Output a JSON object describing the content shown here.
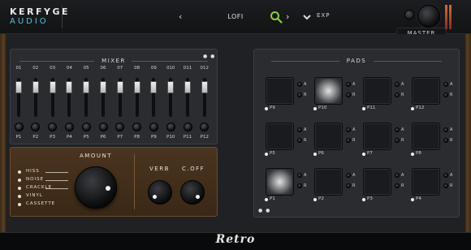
{
  "brand": {
    "top": "KERFYGE",
    "bottom": "AUDIO"
  },
  "preset": {
    "name": "LOFI",
    "prev_glyph": "‹",
    "next_glyph": "›"
  },
  "header": {
    "exp_label": "EXP"
  },
  "master": {
    "label": "MASTER"
  },
  "mixer": {
    "title": "MIXER",
    "dots": "● ●",
    "channels": [
      {
        "bus": "01",
        "pan": "P1"
      },
      {
        "bus": "02",
        "pan": "P2"
      },
      {
        "bus": "03",
        "pan": "P3"
      },
      {
        "bus": "04",
        "pan": "P4"
      },
      {
        "bus": "05",
        "pan": "P5"
      },
      {
        "bus": "06",
        "pan": "P6"
      },
      {
        "bus": "07",
        "pan": "P7"
      },
      {
        "bus": "08",
        "pan": "P8"
      },
      {
        "bus": "09",
        "pan": "P9"
      },
      {
        "bus": "010",
        "pan": "P10"
      },
      {
        "bus": "011",
        "pan": "P11"
      },
      {
        "bus": "012",
        "pan": "P12"
      }
    ]
  },
  "fx": {
    "amount_label": "AMOUNT",
    "items": [
      "HISS",
      "NOISE",
      "CRACKLE",
      "VINYL",
      "CASSETTE"
    ],
    "verb_label": "VERB",
    "cutoff_label": "C.OFF"
  },
  "pads": {
    "title": "PADS",
    "dots": "● ●",
    "ctl_a": "A",
    "ctl_r": "R",
    "rows": [
      [
        "P9",
        "P10",
        "P11",
        "P12"
      ],
      [
        "P5",
        "P6",
        "P7",
        "P8"
      ],
      [
        "P1",
        "P2",
        "P3",
        "P4"
      ]
    ],
    "active": [
      "P10",
      "P1"
    ]
  },
  "footer": {
    "logo": "Retro"
  },
  "colors": {
    "accent": "#55c3d8",
    "search": "#8bd13f",
    "wood": "#5a4024",
    "fx_panel": "#3a2816"
  }
}
